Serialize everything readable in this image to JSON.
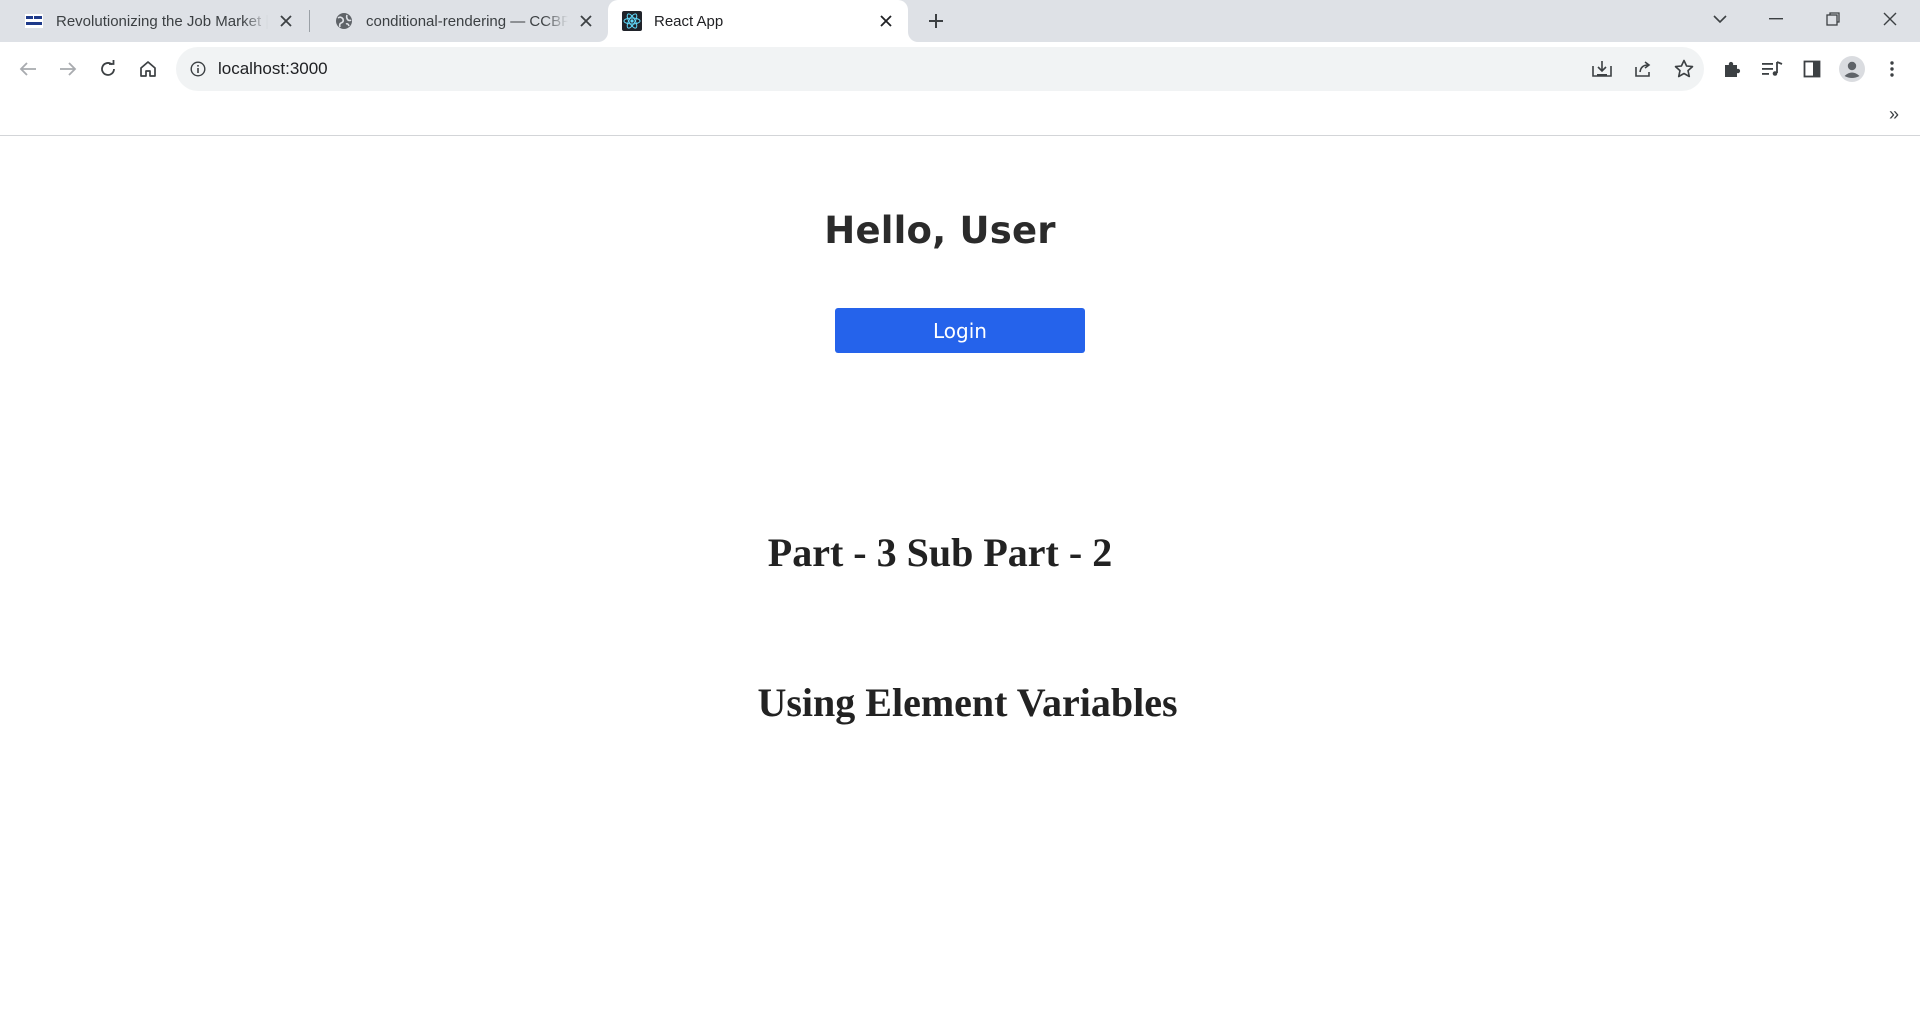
{
  "browser": {
    "tabs": [
      {
        "title": "Revolutionizing the Job Market |",
        "favicon": "nxtwave-logo-icon",
        "active": false
      },
      {
        "title": "conditional-rendering — CCBP ID",
        "favicon": "globe-icon",
        "active": false
      },
      {
        "title": "React App",
        "favicon": "react-logo-icon",
        "active": true
      }
    ],
    "new_tab_glyph": "+",
    "address_bar": {
      "url": "localhost:3000"
    },
    "bookmarks_overflow": "»",
    "icons": {
      "back": "back-arrow-icon",
      "forward": "forward-arrow-icon",
      "reload": "reload-icon",
      "home": "home-icon",
      "install": "install-app-icon",
      "share": "share-icon",
      "bookmark": "star-icon",
      "extensions": "puzzle-piece-icon",
      "media": "media-controls-icon",
      "side_panel": "side-panel-icon",
      "profile": "profile-avatar-icon",
      "menu": "kebab-menu-icon"
    },
    "colors": {
      "tabstrip_bg": "#dee1e6",
      "omnibox_bg": "#f1f3f4"
    }
  },
  "page": {
    "greeting": "Hello, User",
    "login_button": "Login",
    "part_heading": "Part - 3 Sub Part - 2",
    "sub_heading": "Using Element Variables",
    "colors": {
      "button_bg": "#2563eb",
      "button_text": "#ffffff",
      "heading_text": "#2b2b2b"
    }
  }
}
